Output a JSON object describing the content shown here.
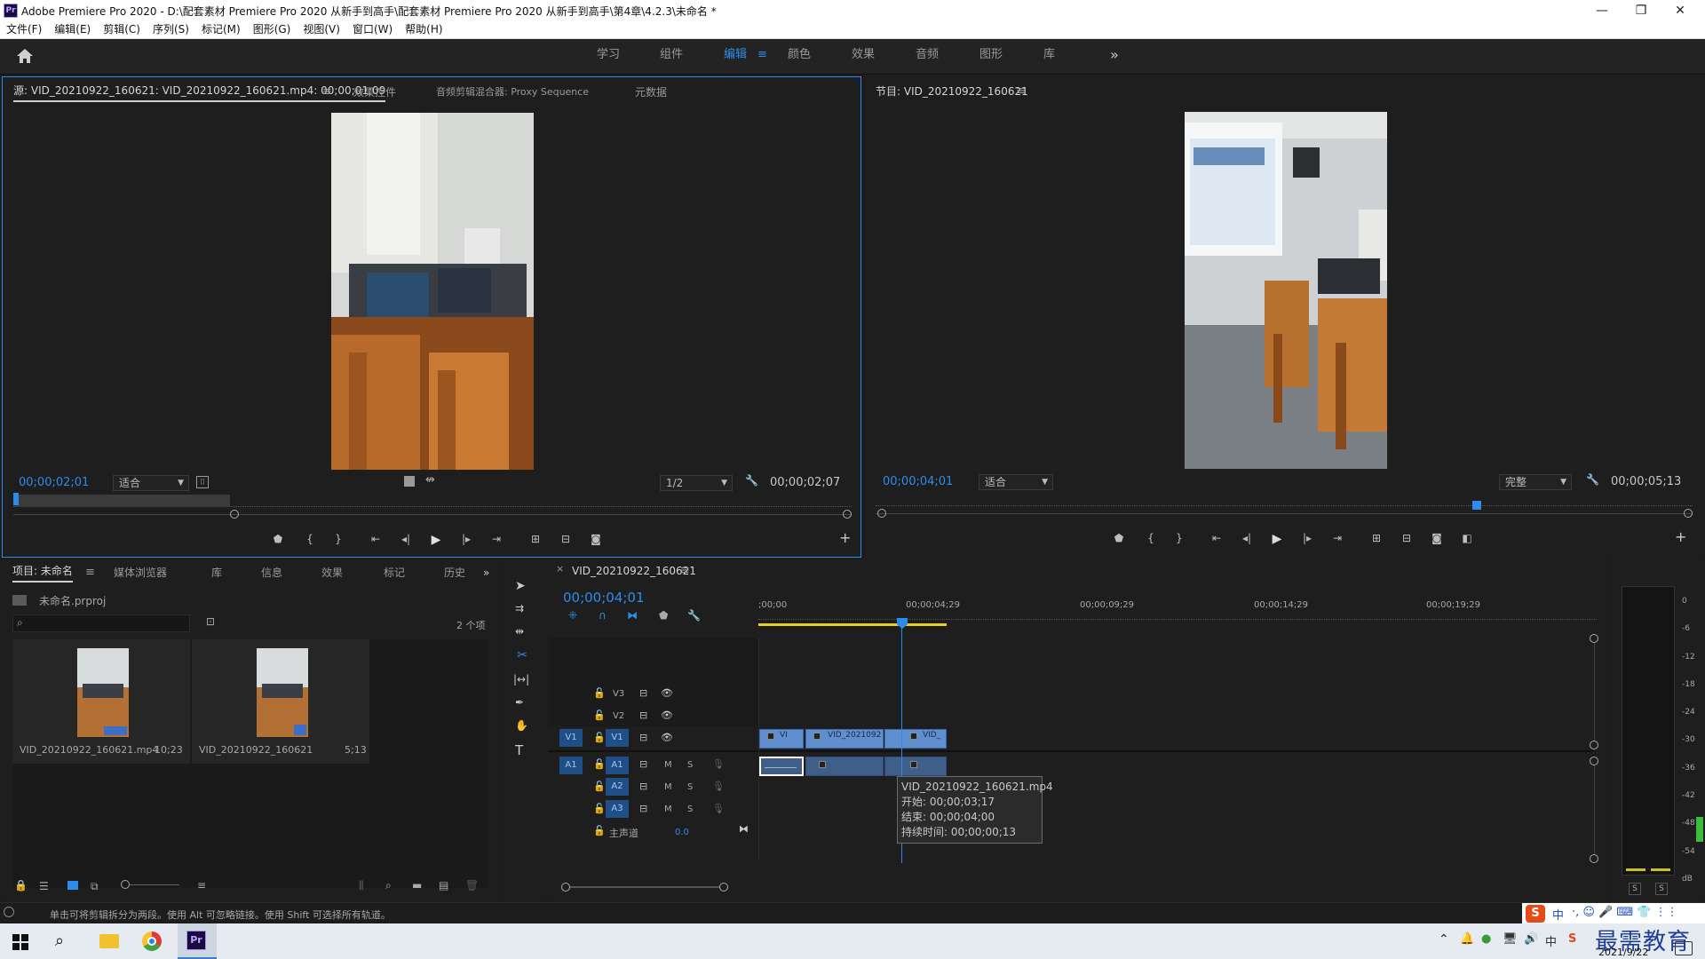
{
  "window": {
    "title": "Adobe Premiere Pro 2020 - D:\\配套素材 Premiere Pro 2020 从新手到高手\\配套素材 Premiere Pro 2020 从新手到高手\\第4章\\4.2.3\\未命名 *",
    "icon": "Pr"
  },
  "menu": [
    "文件(F)",
    "编辑(E)",
    "剪辑(C)",
    "序列(S)",
    "标记(M)",
    "图形(G)",
    "视图(V)",
    "窗口(W)",
    "帮助(H)"
  ],
  "workspaces": {
    "items": [
      "学习",
      "组件",
      "编辑",
      "颜色",
      "效果",
      "音频",
      "图形",
      "库"
    ],
    "active": "编辑",
    "more": "»"
  },
  "source": {
    "tabs": [
      "源: VID_20210922_160621: VID_20210922_160621.mp4: 00;00;01;09",
      "效果控件",
      "音频剪辑混合器: Proxy Sequence",
      "元数据"
    ],
    "timecode": "00;00;02;01",
    "fit": "适合",
    "resolution": "1/2",
    "duration": "00;00;02;07"
  },
  "program": {
    "tab": "节目: VID_20210922_160621",
    "timecode": "00;00;04;01",
    "fit": "适合",
    "quality": "完整",
    "duration": "00;00;05;13"
  },
  "project": {
    "tabs": [
      "项目: 未命名",
      "媒体浏览器",
      "库",
      "信息",
      "效果",
      "标记",
      "历史"
    ],
    "file": "未命名.prproj",
    "count": "2 个项",
    "items": [
      {
        "name": "VID_20210922_160621.mp4",
        "duration": "10;23"
      },
      {
        "name": "VID_20210922_160621",
        "duration": "5;13"
      }
    ]
  },
  "timeline": {
    "tab": "VID_20210922_160621",
    "timecode": "00;00;04;01",
    "ruler": [
      ";00;00",
      "00;00;04;29",
      "00;00;09;29",
      "00;00;14;29",
      "00;00;19;29"
    ],
    "videoTracks": [
      "V3",
      "V2",
      "V1"
    ],
    "audioTracks": [
      "A1",
      "A2",
      "A3"
    ],
    "sourcePatchV": "V1",
    "sourcePatchA": "A1",
    "master": {
      "label": "主声道",
      "value": "0.0"
    },
    "clips": [
      "VI",
      "VID_2021092",
      "VID_"
    ],
    "tooltip": {
      "name": "VID_20210922_160621.mp4",
      "start": "开始: 00;00;03;17",
      "end": "结束: 00;00;04;00",
      "duration": "持续时间: 00;00;00;13"
    },
    "m": "M",
    "s": "S"
  },
  "meter": {
    "scale": [
      "0",
      "-6",
      "-12",
      "-18",
      "-24",
      "-30",
      "-36",
      "-42",
      "-48",
      "-54",
      "dB"
    ],
    "solo": [
      "S",
      "S"
    ]
  },
  "status": "单击可将剪辑拆分为两段。使用 Alt 可忽略链接。使用 Shift 可选择所有轨道。",
  "taskbar": {
    "date": "2021/9/22",
    "watermark": "最需教育",
    "ime": "中"
  }
}
